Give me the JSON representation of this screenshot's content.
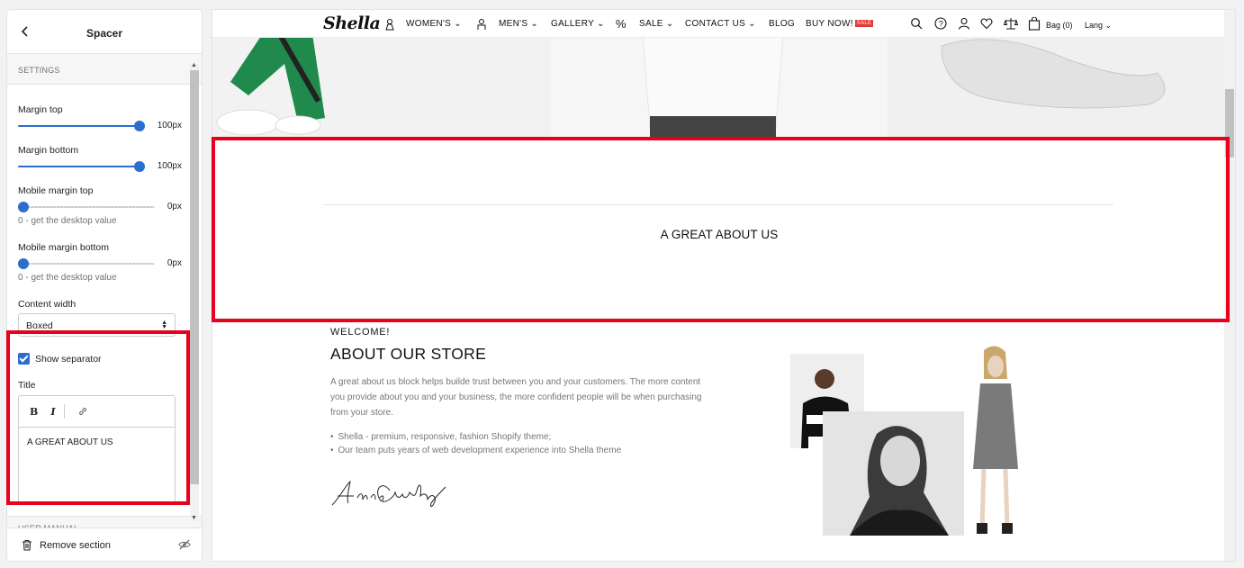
{
  "panel": {
    "title": "Spacer",
    "settings_heading": "SETTINGS",
    "margin_top": {
      "label": "Margin top",
      "value": "100px",
      "level": 1.0
    },
    "margin_bottom": {
      "label": "Margin bottom",
      "value": "100px",
      "level": 1.0
    },
    "mobile_margin_top": {
      "label": "Mobile margin top",
      "value": "0px",
      "help": "0 - get the desktop value",
      "level": 0.0
    },
    "mobile_margin_bottom": {
      "label": "Mobile margin bottom",
      "value": "0px",
      "help": "0 - get the desktop value",
      "level": 0.0
    },
    "content_width": {
      "label": "Content width",
      "selected": "Boxed"
    },
    "show_separator": {
      "label": "Show separator",
      "checked": true
    },
    "title_field": {
      "label": "Title",
      "bold_btn": "B",
      "italic_btn": "I",
      "content": "A GREAT ABOUT US"
    },
    "user_manual_heading": "USER MANUAL",
    "remove_label": "Remove section"
  },
  "preview": {
    "logo": "Shella",
    "nav": {
      "womens": "WOMEN'S",
      "mens": "MEN'S",
      "gallery": "GALLERY",
      "sale": "SALE",
      "contact": "CONTACT US",
      "blog": "BLOG",
      "buy_now": "BUY NOW!",
      "sale_badge": "SALE",
      "bag": "Bag (0)",
      "lang": "Lang"
    },
    "spacer_title": "A GREAT ABOUT US",
    "about": {
      "welcome": "WELCOME!",
      "title": "ABOUT OUR STORE",
      "text": "A great about us block helps builde trust between you and your customers. The more content you provide about you and your business, the more confident people will be when purchasing from your store.",
      "bullets": [
        "Shella - premium, responsive, fashion Shopify theme;",
        "Our team puts years of web development experience into Shella theme"
      ]
    }
  },
  "colors": {
    "accent": "#2c6ecb",
    "highlight": "#e8001c",
    "sale": "#e23a3a"
  }
}
